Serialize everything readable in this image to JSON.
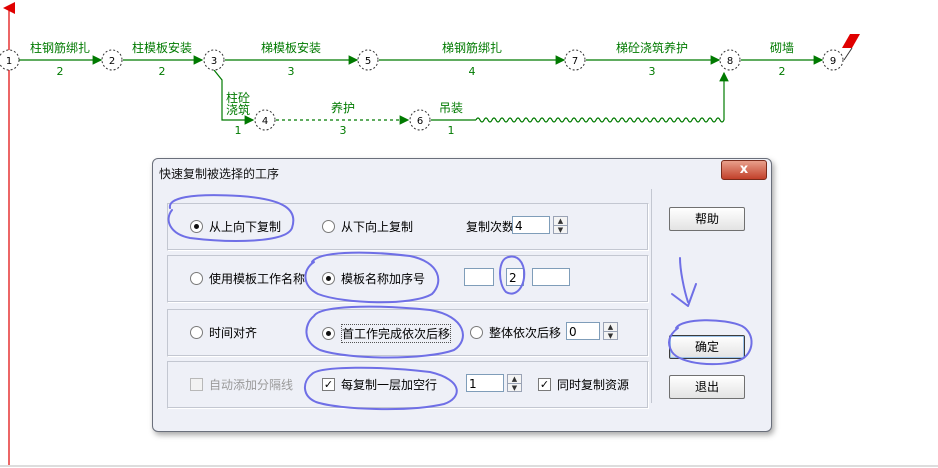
{
  "network": {
    "nodes": [
      "1",
      "2",
      "3",
      "4",
      "5",
      "6",
      "7",
      "8",
      "9"
    ],
    "activities": {
      "a12": {
        "name": "柱钢筋绑扎",
        "duration": "2"
      },
      "a23": {
        "name": "柱模板安装",
        "duration": "2"
      },
      "a35": {
        "name": "梯模板安装",
        "duration": "3"
      },
      "a57": {
        "name": "梯钢筋绑扎",
        "duration": "4"
      },
      "a78": {
        "name": "梯砼浇筑养护",
        "duration": "3"
      },
      "a89": {
        "name": "砌墙",
        "duration": "2"
      },
      "a34": {
        "name_line1": "柱砼",
        "name_line2": "浇筑",
        "duration": "1"
      },
      "a46": {
        "name": "养护",
        "duration": "3"
      },
      "a68": {
        "name": "吊装",
        "duration": "1"
      }
    }
  },
  "dialog": {
    "title": "快速复制被选择的工序",
    "close_glyph": "x",
    "row1": {
      "radio_top_down": "从上向下复制",
      "radio_bottom_up": "从下向上复制",
      "copy_count_label": "复制次数",
      "copy_count_value": "4"
    },
    "row2": {
      "radio_use_template_name": "使用模板工作名称",
      "radio_template_plus_seq": "模板名称加序号",
      "prefix_value": "",
      "seq_value": "2",
      "suffix_value": ""
    },
    "row3": {
      "radio_time_align": "时间对齐",
      "radio_first_work_shift": "首工作完成依次后移",
      "radio_whole_shift": "整体依次后移",
      "shift_value": "0"
    },
    "row4": {
      "check_add_separator": "自动添加分隔线",
      "check_add_blank_row": "每复制一层加空行",
      "blank_row_value": "1",
      "check_copy_resources": "同时复制资源",
      "check_glyph": "✓"
    },
    "buttons": {
      "help": "帮助",
      "ok": "确定",
      "exit": "退出"
    }
  },
  "colors": {
    "network_green": "#007a00",
    "axis_red": "#e00000",
    "annotation_blue": "#6f6fe6"
  }
}
